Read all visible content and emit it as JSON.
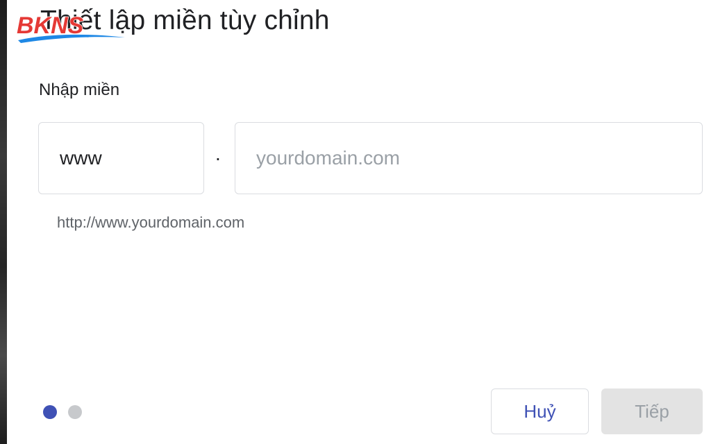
{
  "dialog": {
    "title": "Thiết lập miền tùy chỉnh",
    "section_label": "Nhập miền",
    "subdomain_value": "www",
    "separator": ".",
    "domain_placeholder": "yourdomain.com",
    "hint": "http://www.yourdomain.com",
    "cancel_label": "Huỷ",
    "next_label": "Tiếp",
    "pager": {
      "total": 2,
      "current": 1
    }
  },
  "watermark": {
    "text": "BKNS",
    "color": "#e53935",
    "swoosh_color": "#1e88e5"
  },
  "colors": {
    "accent": "#3f51b5",
    "disabled_bg": "#e3e3e3",
    "disabled_text": "#9aa0a6",
    "border": "#dadce0"
  }
}
